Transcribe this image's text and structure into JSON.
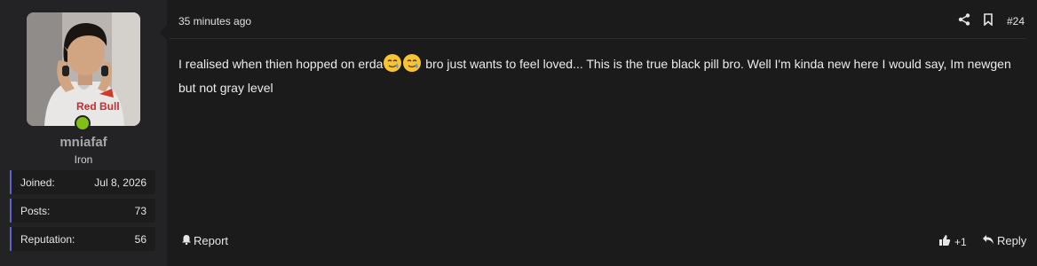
{
  "user": {
    "name": "mniafaf",
    "title": "Iron",
    "stats": [
      {
        "label": "Joined:",
        "value": "Jul 8, 2026"
      },
      {
        "label": "Posts:",
        "value": "73"
      },
      {
        "label": "Reputation:",
        "value": "56"
      }
    ],
    "online": true,
    "avatar_caption": "Red Bull"
  },
  "post": {
    "time": "35 minutes ago",
    "number": "#24",
    "text_before": "I realised when thien hopped on erda",
    "text_after": " bro just wants to feel loved... This is the true black pill bro. Well I'm kinda new here I would say, Im newgen but not gray level",
    "emojis": [
      "smiling-face-with-tear",
      "smiling-face-with-tear"
    ]
  },
  "actions": {
    "report_label": "Report",
    "like_label": "+1",
    "reply_label": "Reply"
  },
  "colors": {
    "accent": "#5c64c4",
    "online": "#7fbf17"
  }
}
